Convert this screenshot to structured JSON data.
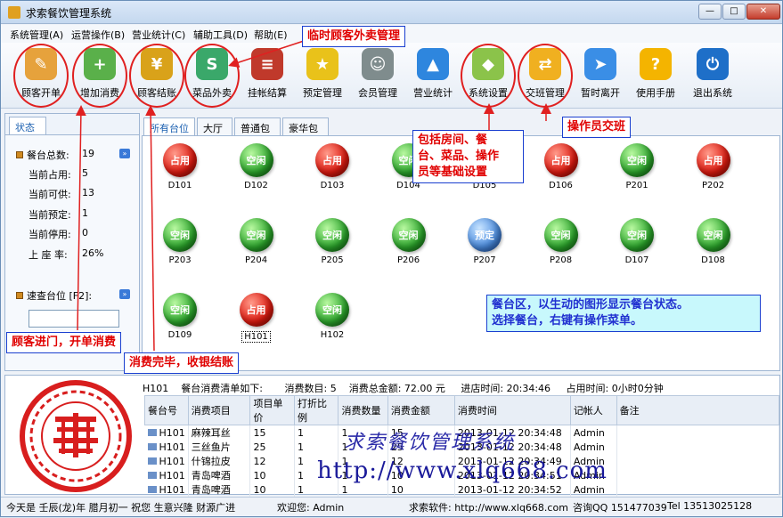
{
  "window": {
    "title": "求索餐饮管理系统",
    "min": "—",
    "max": "□",
    "close": "✕"
  },
  "menu": [
    {
      "label": "系统管理(A)"
    },
    {
      "label": "运营操作(B)"
    },
    {
      "label": "营业统计(C)"
    },
    {
      "label": "辅助工具(D)"
    },
    {
      "label": "帮助(E)"
    }
  ],
  "toolbar": [
    {
      "label": "顾客开单",
      "icon": "open-order-icon",
      "color": "#e6a23c"
    },
    {
      "label": "增加消费",
      "icon": "add-consumption-icon",
      "color": "#5ab04a"
    },
    {
      "label": "顾客结账",
      "icon": "checkout-coins-icon",
      "color": "#d9a21a"
    },
    {
      "label": "菜品外卖",
      "icon": "takeout-sale-icon",
      "color": "#3aa86a"
    },
    {
      "label": "挂帐结算",
      "icon": "credit-settle-icon",
      "color": "#c0392b"
    },
    {
      "label": "预定管理",
      "icon": "reservation-star-icon",
      "color": "#e9c21a"
    },
    {
      "label": "会员管理",
      "icon": "member-group-icon",
      "color": "#7f8c8d"
    },
    {
      "label": "营业统计",
      "icon": "statistics-chart-icon",
      "color": "#2e86de"
    },
    {
      "label": "系统设置",
      "icon": "settings-blocks-icon",
      "color": "#8bc34a"
    },
    {
      "label": "交班管理",
      "icon": "shift-handover-icon",
      "color": "#f0b020"
    },
    {
      "label": "暂时离开",
      "icon": "away-runner-icon",
      "color": "#3a8ee6"
    },
    {
      "label": "使用手册",
      "icon": "help-question-icon",
      "color": "#f4b400"
    },
    {
      "label": "退出系统",
      "icon": "power-exit-icon",
      "color": "#1e6fc8"
    }
  ],
  "callouts": {
    "takeout": "临时顾客外卖管理",
    "settings": "包括房间、餐台、菜品、操作员等基础设置",
    "settings_lines": [
      "包括房间、餐",
      "台、菜品、操作",
      "员等基础设置"
    ],
    "shift": "操作员交班",
    "area_line1": "餐台区，以生动的图形显示餐台状态。",
    "area_line2": "选择餐台，右键有操作菜单。",
    "open": "顾客进门，开单消费",
    "checkout": "消费完毕，收银结账"
  },
  "left": {
    "tab": "状态",
    "stats": [
      {
        "label": "餐台总数:",
        "value": "19"
      },
      {
        "label": "当前占用:",
        "value": "5"
      },
      {
        "label": "当前可供:",
        "value": "13"
      },
      {
        "label": "当前预定:",
        "value": "1"
      },
      {
        "label": "当前停用:",
        "value": "0"
      },
      {
        "label": "上 座 率:",
        "value": "26%"
      }
    ],
    "quick_label": "速查台位 [F2]:",
    "quick_value": ""
  },
  "tabs": [
    {
      "label": "所有台位"
    },
    {
      "label": "大厅"
    },
    {
      "label": "普通包间"
    },
    {
      "label": "豪华包间"
    }
  ],
  "status_labels": {
    "occ": "占用",
    "free": "空闲",
    "res": "预定"
  },
  "seats": [
    {
      "name": "D101",
      "status": "occ"
    },
    {
      "name": "D102",
      "status": "free"
    },
    {
      "name": "D103",
      "status": "occ"
    },
    {
      "name": "D104",
      "status": "free"
    },
    {
      "name": "D105",
      "status": "free"
    },
    {
      "name": "D106",
      "status": "occ"
    },
    {
      "name": "P201",
      "status": "free"
    },
    {
      "name": "P202",
      "status": "occ"
    },
    {
      "name": "P203",
      "status": "free"
    },
    {
      "name": "P204",
      "status": "free"
    },
    {
      "name": "P205",
      "status": "free"
    },
    {
      "name": "P206",
      "status": "free"
    },
    {
      "name": "P207",
      "status": "res"
    },
    {
      "name": "P208",
      "status": "free"
    },
    {
      "name": "D107",
      "status": "free"
    },
    {
      "name": "D108",
      "status": "free"
    },
    {
      "name": "D109",
      "status": "free"
    },
    {
      "name": "H101",
      "status": "occ"
    },
    {
      "name": "H102",
      "status": "free"
    }
  ],
  "detail": {
    "table": "H101",
    "caption": "餐台消费清单如下:",
    "count_label": "消费数目:",
    "count": "5",
    "total_label": "消费总金额:",
    "total": "72.00 元",
    "in_label": "进店时间:",
    "in_time": "20:34:46",
    "occupy_label": "占用时间:",
    "occupy": "0小时0分钟"
  },
  "columns": [
    "餐台号",
    "消费项目",
    "项目单价",
    "打折比例",
    "消费数量",
    "消费金额",
    "消费时间",
    "记帐人",
    "备注"
  ],
  "rows": [
    [
      "H101",
      "麻辣耳丝",
      "15",
      "1",
      "1",
      "15",
      "2013-01-12 20:34:48",
      "Admin",
      ""
    ],
    [
      "H101",
      "三丝鱼片",
      "25",
      "1",
      "1",
      "25",
      "2013-01-12 20:34:48",
      "Admin",
      ""
    ],
    [
      "H101",
      "什锦拉皮",
      "12",
      "1",
      "1",
      "12",
      "2013-01-12 20:34:49",
      "Admin",
      ""
    ],
    [
      "H101",
      "青岛啤酒",
      "10",
      "1",
      "1",
      "10",
      "2013-01-12 20:34:51",
      "Admin",
      ""
    ],
    [
      "H101",
      "青岛啤酒",
      "10",
      "1",
      "1",
      "10",
      "2013-01-12 20:34:52",
      "Admin",
      ""
    ]
  ],
  "watermark": {
    "line1": "求索餐饮管理系统",
    "line2": "http://www.xlq668.com"
  },
  "statusbar": {
    "today": "今天是 壬辰(龙)年 腊月初一 祝您 生意兴隆 财源广进",
    "welcome": "欢迎您: Admin",
    "software": "求索软件: http://www.xlq668.com",
    "qq": "咨询QQ 151477039",
    "tel": "Tel 13513025128"
  },
  "colors": {
    "accent": "#1a5fb0",
    "callout_red": "#e00000",
    "highlight": "#e02020"
  }
}
